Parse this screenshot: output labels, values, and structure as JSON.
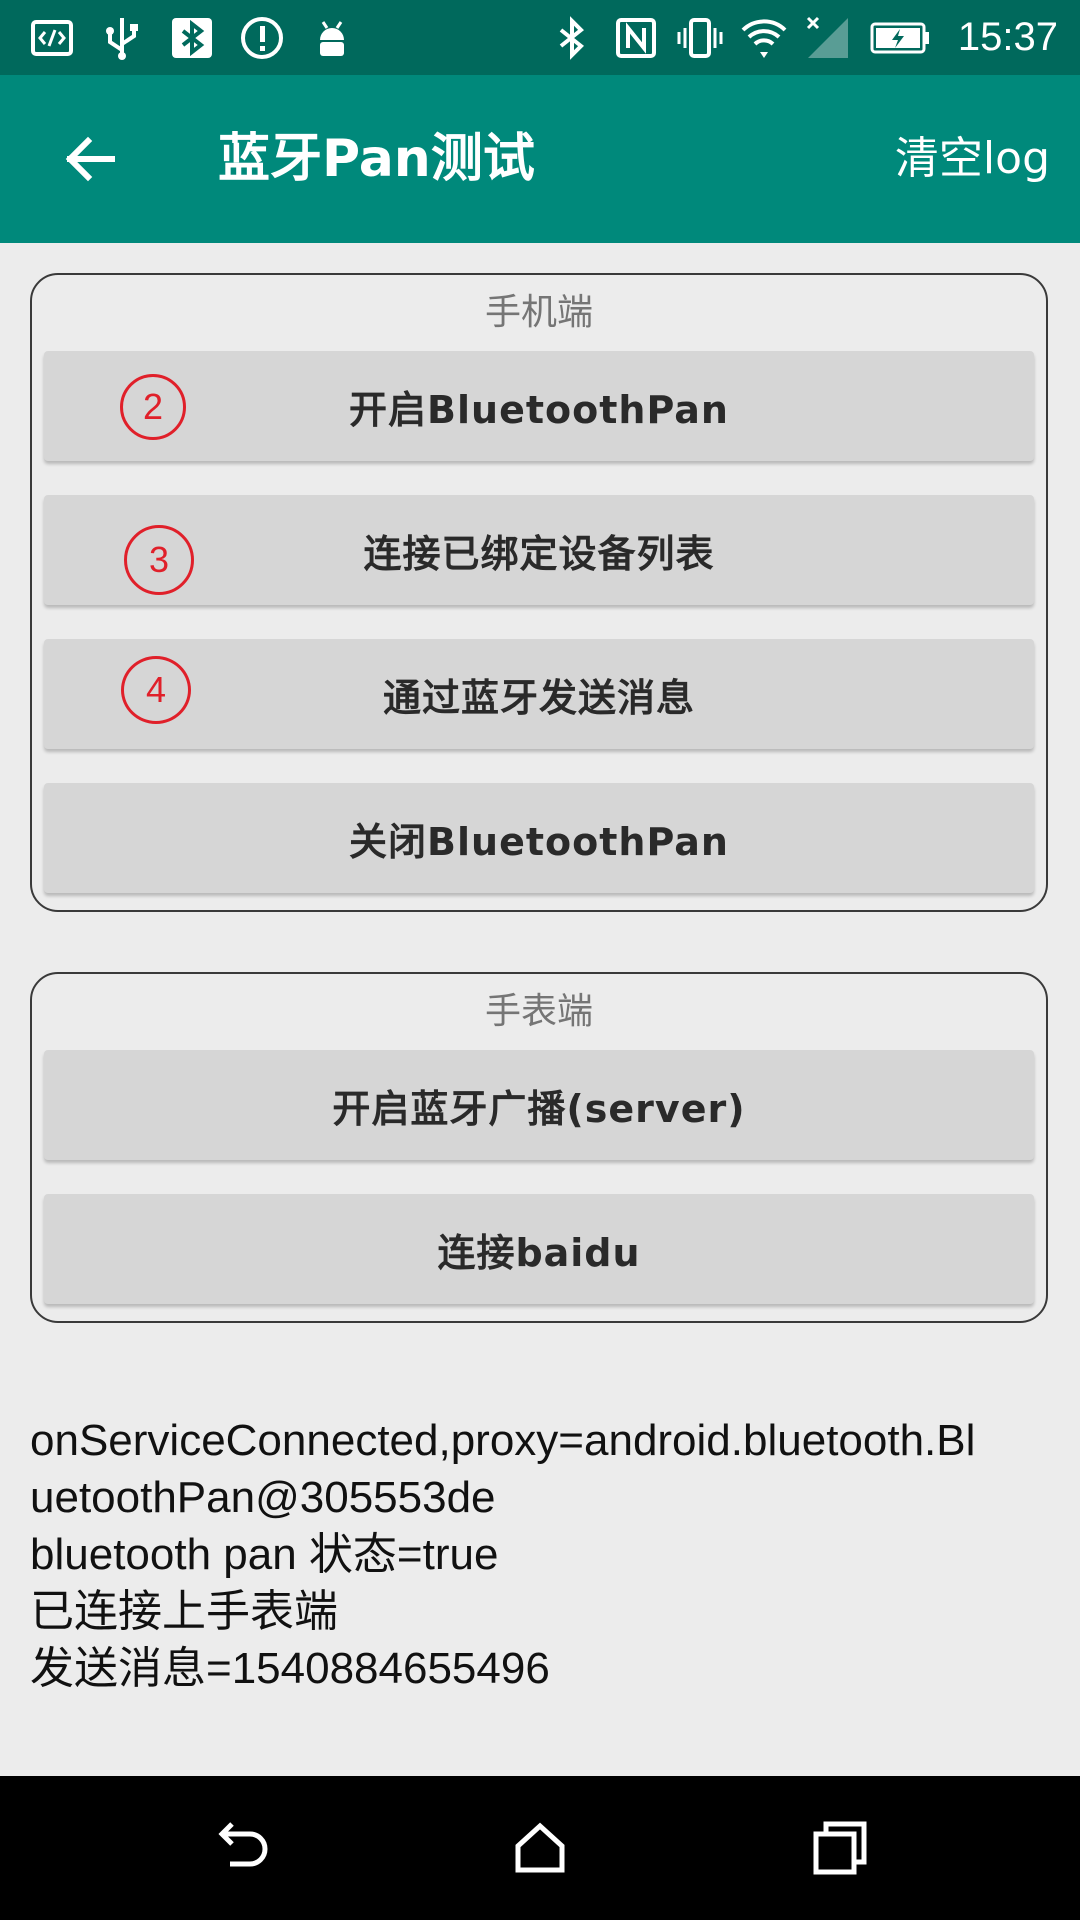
{
  "status_bar": {
    "time": "15:37",
    "left_icons": [
      "code-icon",
      "usb-icon",
      "bluetooth-icon",
      "alert-icon",
      "android-icon"
    ],
    "right_icons": [
      "bluetooth-icon",
      "nfc-icon",
      "vibrate-icon",
      "wifi-icon",
      "signal-icon",
      "battery-icon"
    ]
  },
  "app_bar": {
    "title": "蓝牙Pan测试",
    "action_label": "清空log",
    "back_icon": "arrow-left-icon"
  },
  "phone_section": {
    "title": "手机端",
    "buttons": [
      {
        "label": "开启BluetoothPan",
        "mark": "2"
      },
      {
        "label": "连接已绑定设备列表",
        "mark": "3"
      },
      {
        "label": "通过蓝牙发送消息",
        "mark": "4"
      },
      {
        "label": "关闭BluetoothPan"
      }
    ]
  },
  "watch_section": {
    "title": "手表端",
    "buttons": [
      {
        "label": "开启蓝牙广播(server)"
      },
      {
        "label": "连接baidu"
      }
    ]
  },
  "log": {
    "lines": [
      "onServiceConnected,proxy=android.bluetooth.Bl",
      "uetoothPan@305553de",
      "bluetooth pan 状态=true",
      "已连接上手表端",
      "发送消息=1540884655496"
    ]
  },
  "nav_bar": {
    "icons": [
      "back-icon",
      "home-icon",
      "recents-icon"
    ]
  },
  "colors": {
    "status_bar": "#00695c",
    "app_bar": "#00897b",
    "background": "#ececec",
    "button": "#d6d6d6",
    "annotation": "#e0202a"
  }
}
